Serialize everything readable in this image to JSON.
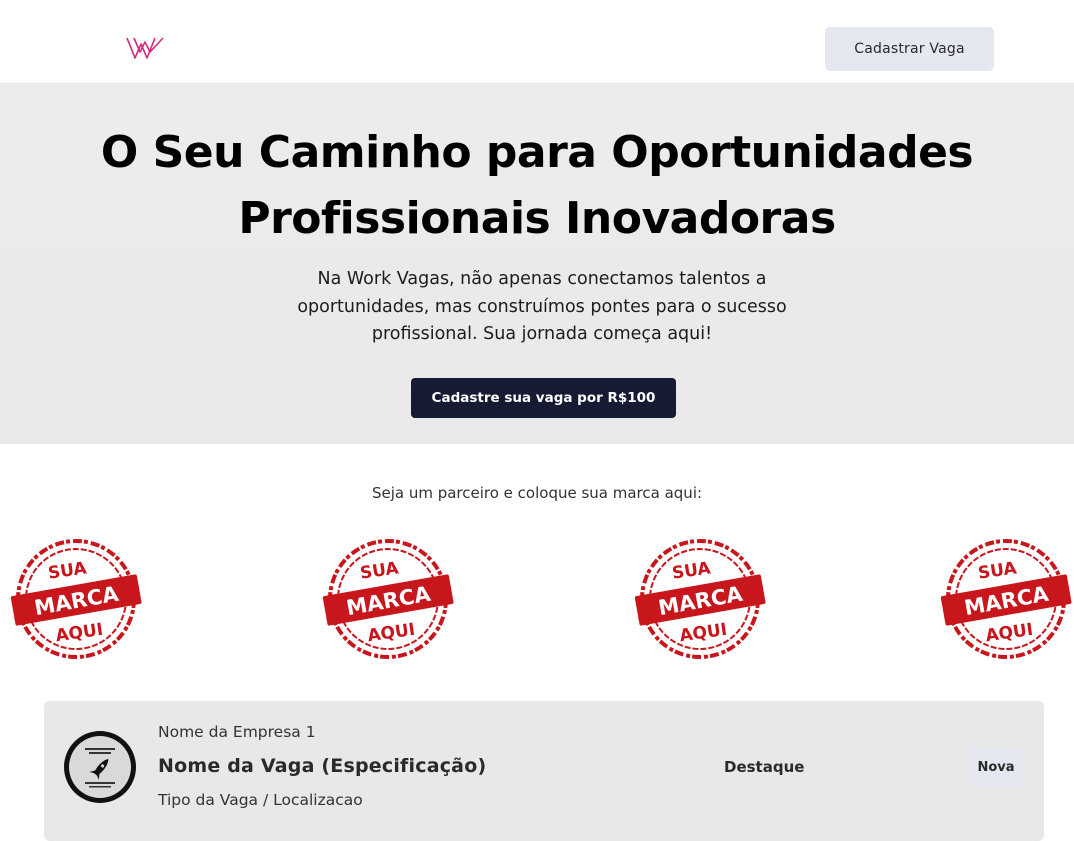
{
  "header": {
    "logo_icon": "work-vagas-w-logo",
    "register_button_label": "Cadastrar Vaga"
  },
  "hero": {
    "title": "O Seu Caminho para Oportunidades Profissionais Inovadoras",
    "subtitle": "Na Work Vagas, não apenas conectamos talentos a oportunidades, mas construímos pontes para o sucesso profissional. Sua jornada começa aqui!",
    "cta_label": "Cadastre sua vaga por R$100"
  },
  "partners": {
    "label": "Seja um parceiro e coloque sua marca aqui:",
    "stamps": [
      {
        "top": "SUA",
        "middle": "MARCA",
        "bottom": "AQUI"
      },
      {
        "top": "SUA",
        "middle": "MARCA",
        "bottom": "AQUI"
      },
      {
        "top": "SUA",
        "middle": "MARCA",
        "bottom": "AQUI"
      },
      {
        "top": "SUA",
        "middle": "MARCA",
        "bottom": "AQUI"
      }
    ],
    "stamp_color": "#c8161d"
  },
  "jobs": [
    {
      "company": "Nome da Empresa 1",
      "title": "Nome da Vaga (Especificação)",
      "type_location": "Tipo da Vaga / Localizacao",
      "highlight": "Destaque",
      "badge": "Nova",
      "logo_icon": "rocket-icon"
    }
  ],
  "colors": {
    "brand_pink": "#d6297a",
    "cta_dark": "#161b33",
    "light_button": "#e6e8f1"
  }
}
